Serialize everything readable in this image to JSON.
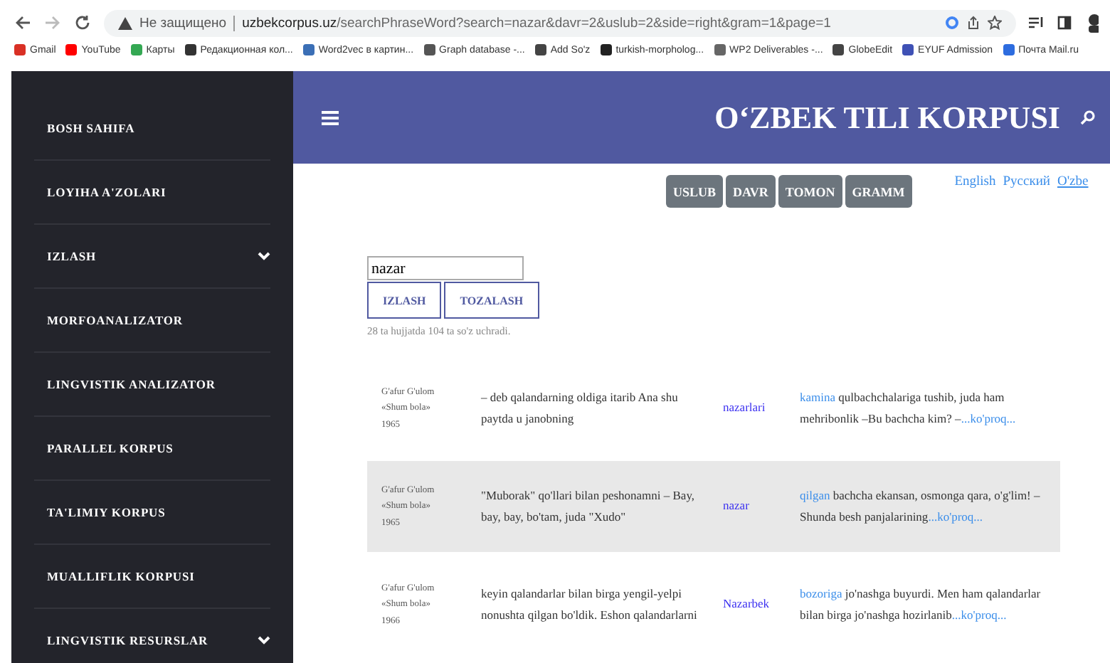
{
  "browser": {
    "security": "Не защищено",
    "url_host": "uzbekcorpus.uz",
    "url_path": "/searchPhraseWord?search=nazar&davr=2&uslub=2&side=right&gram=1&page=1",
    "bookmarks": [
      {
        "label": "Gmail",
        "color": "#d93025"
      },
      {
        "label": "YouTube",
        "color": "#ff0000"
      },
      {
        "label": "Карты",
        "color": "#34a853"
      },
      {
        "label": "Редакционная кол...",
        "color": "#333333"
      },
      {
        "label": "Word2vec в картин...",
        "color": "#3b6fb6"
      },
      {
        "label": "Graph database -...",
        "color": "#555555"
      },
      {
        "label": "Add So'z",
        "color": "#444444"
      },
      {
        "label": "turkish-morpholog...",
        "color": "#222222"
      },
      {
        "label": "WP2 Deliverables -...",
        "color": "#666666"
      },
      {
        "label": "GlobeEdit",
        "color": "#444444"
      },
      {
        "label": "EYUF Admission",
        "color": "#3f51b5"
      },
      {
        "label": "Почта Mail.ru",
        "color": "#2d6cdf"
      }
    ]
  },
  "sidebar": {
    "items": [
      {
        "label": "BOSH SAHIFA",
        "expandable": false
      },
      {
        "label": "LOYIHA A'ZOLARI",
        "expandable": false
      },
      {
        "label": "IZLASH",
        "expandable": true
      },
      {
        "label": "MORFOANALIZATOR",
        "expandable": false
      },
      {
        "label": "LINGVISTIK ANALIZATOR",
        "expandable": false
      },
      {
        "label": "PARALLEL KORPUS",
        "expandable": false
      },
      {
        "label": "TA'LIMIY KORPUS",
        "expandable": false
      },
      {
        "label": "MUALLIFLIK KORPUSI",
        "expandable": false
      },
      {
        "label": "LINGVISTIK RESURSLAR",
        "expandable": true
      }
    ]
  },
  "header": {
    "title": "O‘ZBEK TILI KORPUSI"
  },
  "filters": [
    "USLUB",
    "DAVR",
    "TOMON",
    "GRAMM"
  ],
  "languages": [
    {
      "label": "English",
      "selected": false
    },
    {
      "label": "Русский",
      "selected": false
    },
    {
      "label": "O'zbe",
      "selected": true
    }
  ],
  "search": {
    "value": "nazar",
    "buttons": [
      "IZLASH",
      "TOZALASH"
    ],
    "summary": "28 ta hujjatda 104 ta so'z uchradi."
  },
  "results": [
    {
      "author": "G'afur G'ulom",
      "work": "«Shum bola»",
      "year": "1965",
      "left": "– deb qalandarning oldiga itarib Ana shu paytda u janobning",
      "keyword": "nazarlari",
      "right_first": "kamina",
      "right_rest": "qulbachchalariga tushib, juda ham mehribonlik –Bu bachcha kim? –",
      "more": "...ko'proq...",
      "shaded": false
    },
    {
      "author": "G'afur G'ulom",
      "work": "«Shum bola»",
      "year": "1965",
      "left": "\"Muborak\" qo'llari bilan peshonamni – Bay, bay, bay, bo'tam, juda \"Xudo\"",
      "keyword": "nazar",
      "right_first": "qilgan",
      "right_rest": "bachcha ekansan, osmonga qara, o'g'lim! – Shunda besh panjalarining",
      "more": "...ko'proq...",
      "shaded": true
    },
    {
      "author": "G'afur G'ulom",
      "work": "«Shum bola»",
      "year": "1966",
      "left": "keyin qalandarlar bilan birga yengil-yelpi nonushta qilgan bo'ldik. Eshon qalandarlarni",
      "keyword": "Nazarbek",
      "right_first": "bozoriga",
      "right_rest": "jo'nashga buyurdi. Men ham qalandarlar bilan birga jo'nashga hozirlanib",
      "more": "...ko'proq...",
      "shaded": false
    }
  ]
}
